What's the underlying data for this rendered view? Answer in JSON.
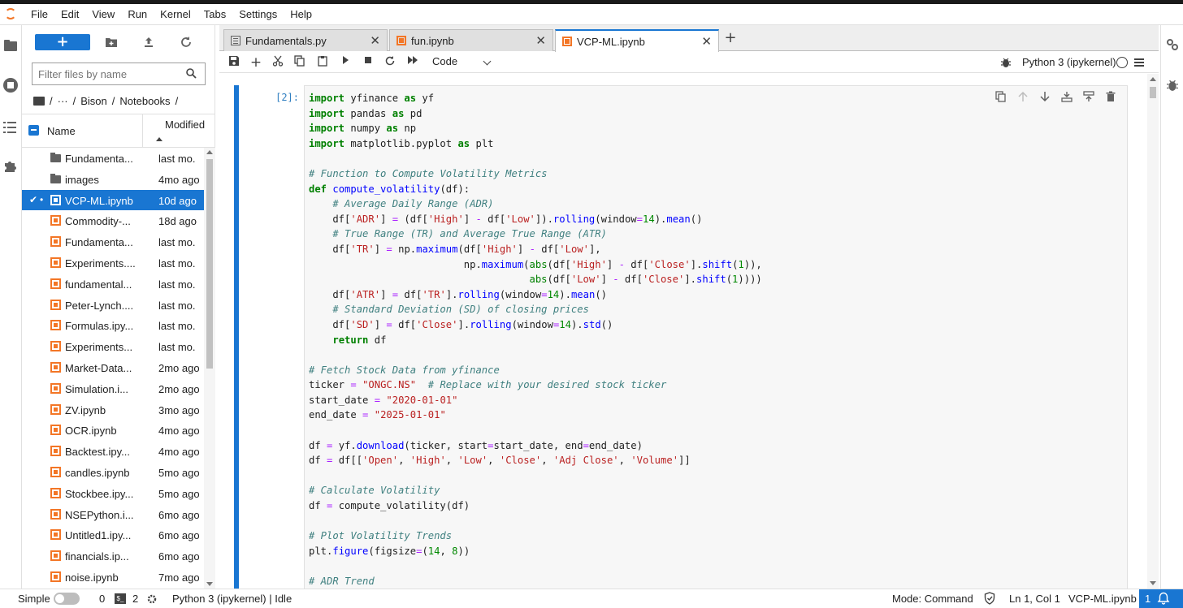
{
  "menubar": {
    "items": [
      "File",
      "Edit",
      "View",
      "Run",
      "Kernel",
      "Tabs",
      "Settings",
      "Help"
    ]
  },
  "filebrowser": {
    "new_label": "+",
    "filter_placeholder": "Filter files by name",
    "breadcrumb": [
      "/",
      "···",
      "/",
      "Bison",
      "/",
      "Notebooks",
      "/"
    ],
    "col_name": "Name",
    "col_modified": "Modified",
    "files": [
      {
        "name": "Fundamenta...",
        "modified": "last mo.",
        "type": "folder"
      },
      {
        "name": "images",
        "modified": "4mo ago",
        "type": "folder"
      },
      {
        "name": "VCP-ML.ipynb",
        "modified": "10d ago",
        "type": "notebook",
        "selected": true
      },
      {
        "name": "Commodity-...",
        "modified": "18d ago",
        "type": "notebook"
      },
      {
        "name": "Fundamenta...",
        "modified": "last mo.",
        "type": "notebook"
      },
      {
        "name": "Experiments....",
        "modified": "last mo.",
        "type": "notebook"
      },
      {
        "name": "fundamental...",
        "modified": "last mo.",
        "type": "notebook"
      },
      {
        "name": "Peter-Lynch....",
        "modified": "last mo.",
        "type": "notebook"
      },
      {
        "name": "Formulas.ipy...",
        "modified": "last mo.",
        "type": "notebook"
      },
      {
        "name": "Experiments...",
        "modified": "last mo.",
        "type": "notebook"
      },
      {
        "name": "Market-Data...",
        "modified": "2mo ago",
        "type": "notebook"
      },
      {
        "name": "Simulation.i...",
        "modified": "2mo ago",
        "type": "notebook"
      },
      {
        "name": "ZV.ipynb",
        "modified": "3mo ago",
        "type": "notebook"
      },
      {
        "name": "OCR.ipynb",
        "modified": "4mo ago",
        "type": "notebook"
      },
      {
        "name": "Backtest.ipy...",
        "modified": "4mo ago",
        "type": "notebook"
      },
      {
        "name": "candles.ipynb",
        "modified": "5mo ago",
        "type": "notebook"
      },
      {
        "name": "Stockbee.ipy...",
        "modified": "5mo ago",
        "type": "notebook"
      },
      {
        "name": "NSEPython.i...",
        "modified": "6mo ago",
        "type": "notebook"
      },
      {
        "name": "Untitled1.ipy...",
        "modified": "6mo ago",
        "type": "notebook"
      },
      {
        "name": "financials.ip...",
        "modified": "6mo ago",
        "type": "notebook"
      },
      {
        "name": "noise.ipynb",
        "modified": "7mo ago",
        "type": "notebook"
      }
    ]
  },
  "tabs": [
    {
      "label": "Fundamentals.py",
      "type": "py"
    },
    {
      "label": "fun.ipynb",
      "type": "nb"
    },
    {
      "label": "VCP-ML.ipynb",
      "type": "nb",
      "active": true
    }
  ],
  "nbtoolbar": {
    "cell_type": "Code",
    "kernel_name": "Python 3 (ipykernel)"
  },
  "cell": {
    "prompt": "[2]:"
  },
  "statusbar": {
    "simple_label": "Simple",
    "terminals_count": "0",
    "kernels_count": "2",
    "kernel_status": "Python 3 (ipykernel) | Idle",
    "mode": "Mode: Command",
    "cursor": "Ln 1, Col 1",
    "filename": "VCP-ML.ipynb",
    "notifications": "1"
  },
  "colors": {
    "accent": "#1976d2",
    "notebook_orange": "#f37626"
  }
}
